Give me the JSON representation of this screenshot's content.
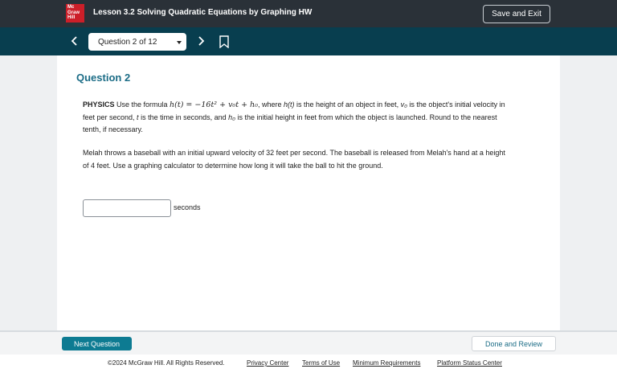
{
  "header": {
    "logo_lines": [
      "Mc",
      "Graw",
      "Hill"
    ],
    "lesson_title": "Lesson 3.2 Solving Quadratic Equations by Graphing HW",
    "save_exit_label": "Save and Exit"
  },
  "nav": {
    "question_select": "Question 2 of 12",
    "icons": [
      "chevron-left-icon",
      "chevron-right-icon",
      "bookmark-icon"
    ]
  },
  "question": {
    "heading": "Question 2",
    "subject": "PHYSICS",
    "p1_a": " Use the formula ",
    "formula": "h(t) = −16t² + v₀t + h₀",
    "p1_b": ", where ",
    "h_t": "h(t)",
    "p1_c": " is the height of an object in feet, ",
    "v0": "v₀",
    "p1_d": " is the object's initial velocity in feet per second, ",
    "t": "t",
    "p1_e": " is the time in seconds, and ",
    "h0": "h₀",
    "p1_f": " is the initial height in feet from which the object is launched. Round to the nearest tenth, if necessary.",
    "p2": "Melah throws a baseball with an initial upward velocity of 32 feet per second. The baseball is released from Melah's hand at a height of 4 feet. Use a graphing calculator to determine how long it will take the ball to hit the ground.",
    "answer_value": "",
    "unit": "seconds"
  },
  "bottom": {
    "next_label": "Next Question",
    "done_label": "Done and Review"
  },
  "footer": {
    "copyright": "©2024 McGraw Hill. All Rights Reserved.",
    "links": [
      "Privacy Center",
      "Terms of Use",
      "Minimum Requirements",
      "Platform Status Center"
    ]
  },
  "colors": {
    "header_bg": "#2a3138",
    "nav_bg": "#083e4f",
    "accent": "#1b6c86",
    "button": "#0d7b92",
    "logo": "#cc1f29"
  }
}
